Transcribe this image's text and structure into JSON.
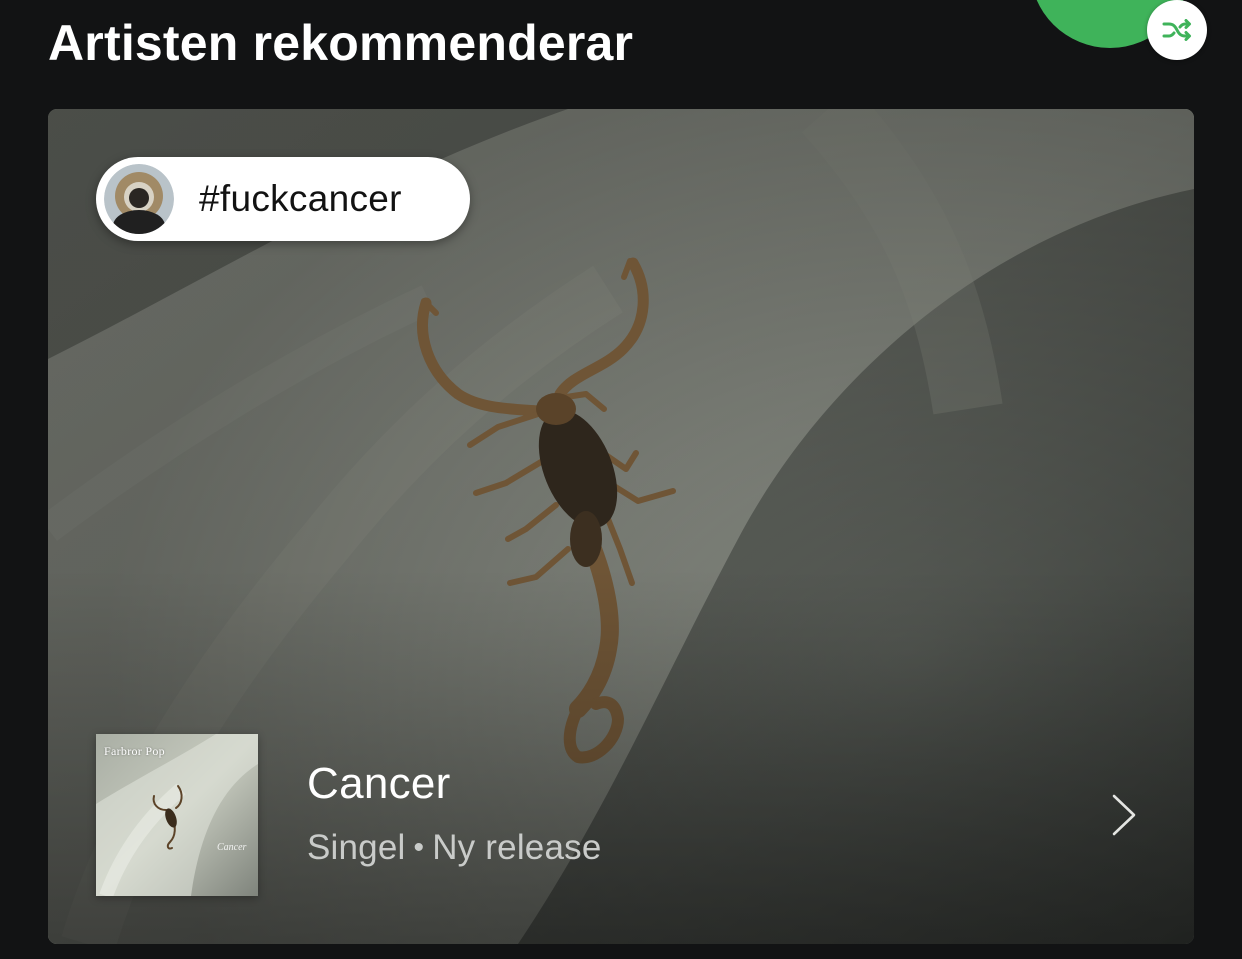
{
  "section": {
    "title": "Artisten rekommenderar"
  },
  "header_controls": {
    "play_button_icon": "play-button",
    "shuffle_icon": "shuffle-icon",
    "accent_color": "#3fb35a"
  },
  "promo": {
    "comment": "#fuckcancer",
    "avatar_icon": "artist-avatar",
    "release": {
      "title": "Cancer",
      "type": "Singel",
      "separator": "•",
      "status": "Ny release",
      "chevron_icon": "chevron-right-icon"
    },
    "cover": {
      "artist_text": "Farbror Pop",
      "title_text": "Cancer"
    }
  }
}
